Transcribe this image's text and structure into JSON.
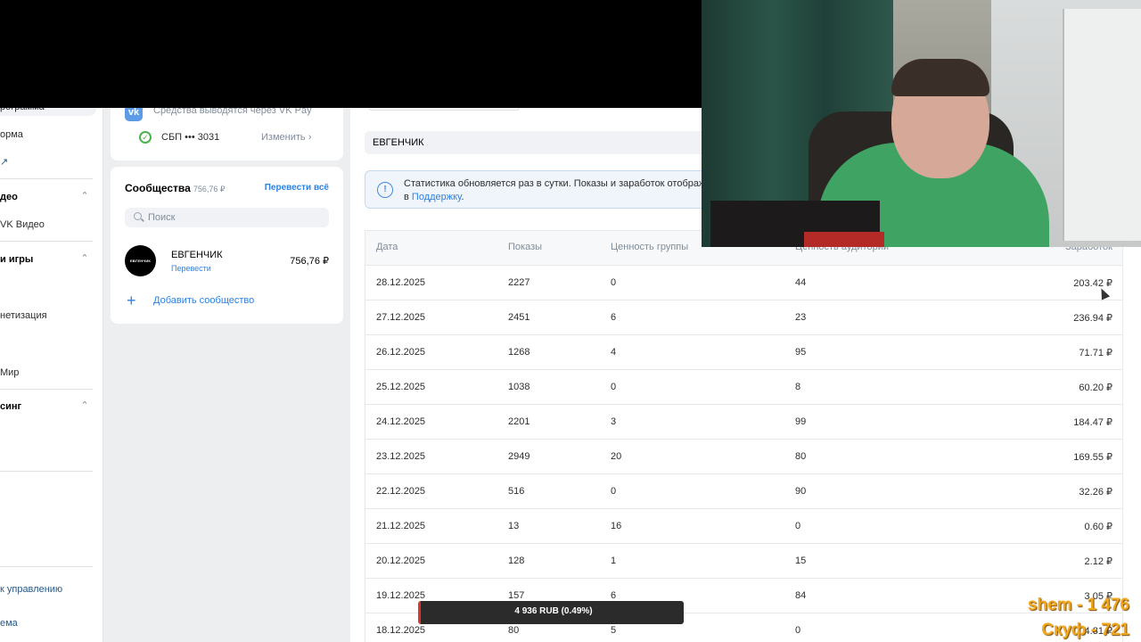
{
  "left_nav": {
    "items": [
      {
        "label": "рограмма"
      },
      {
        "label": "орма"
      },
      {
        "label": "↗"
      }
    ],
    "sections": [
      {
        "title": "део",
        "items": [
          {
            "label": "VK Видео"
          }
        ]
      },
      {
        "title": "и игры",
        "items": [
          {
            "label": "нетизация"
          },
          {
            "label": "Мир"
          }
        ]
      },
      {
        "title": "синг",
        "items": []
      }
    ],
    "footer_links": [
      {
        "label": "к управлению"
      },
      {
        "label": "ема"
      }
    ]
  },
  "payout": {
    "note": "Средства выводятся через VK Pay",
    "method": "СБП ••• 3031",
    "change_label": "Изменить"
  },
  "communities": {
    "title": "Сообщества",
    "total": "756,76 ₽",
    "transfer_all_label": "Перевести всё",
    "search_placeholder": "Поиск",
    "items": [
      {
        "avatar_text": "ЕВГЕНЧИК",
        "name": "ЕВГЕНЧИК",
        "transfer_label": "Перевести",
        "amount": "756,76 ₽"
      }
    ],
    "add_label": "Добавить сообщество"
  },
  "main": {
    "group_name": "ЕВГЕНЧИК",
    "info_line1": "Статистика обновляется раз в сутки. Показы и заработок отобража",
    "info_line2_prefix": "в ",
    "info_link": "Поддержку",
    "info_line2_suffix": ".",
    "table": {
      "headers": {
        "date": "Дата",
        "views": "Показы",
        "group_value": "Ценность группы",
        "audience_value": "Ценность аудитории",
        "earnings": "Заработок"
      },
      "rows": [
        {
          "date": "28.12.2025",
          "views": "2227",
          "group_value": "0",
          "audience_value": "44",
          "earnings": "203.42 ₽"
        },
        {
          "date": "27.12.2025",
          "views": "2451",
          "group_value": "6",
          "audience_value": "23",
          "earnings": "236.94 ₽"
        },
        {
          "date": "26.12.2025",
          "views": "1268",
          "group_value": "4",
          "audience_value": "95",
          "earnings": "71.71 ₽"
        },
        {
          "date": "25.12.2025",
          "views": "1038",
          "group_value": "0",
          "audience_value": "8",
          "earnings": "60.20 ₽"
        },
        {
          "date": "24.12.2025",
          "views": "2201",
          "group_value": "3",
          "audience_value": "99",
          "earnings": "184.47 ₽"
        },
        {
          "date": "23.12.2025",
          "views": "2949",
          "group_value": "20",
          "audience_value": "80",
          "earnings": "169.55 ₽"
        },
        {
          "date": "22.12.2025",
          "views": "516",
          "group_value": "0",
          "audience_value": "90",
          "earnings": "32.26 ₽"
        },
        {
          "date": "21.12.2025",
          "views": "13",
          "group_value": "16",
          "audience_value": "0",
          "earnings": "0.60 ₽"
        },
        {
          "date": "20.12.2025",
          "views": "128",
          "group_value": "1",
          "audience_value": "15",
          "earnings": "2.12 ₽"
        },
        {
          "date": "19.12.2025",
          "views": "157",
          "group_value": "6",
          "audience_value": "84",
          "earnings": "3.05 ₽"
        },
        {
          "date": "18.12.2025",
          "views": "80",
          "group_value": "5",
          "audience_value": "0",
          "earnings": "4.81 ₽"
        }
      ]
    }
  },
  "overlays": {
    "donation_goal": "4 936 RUB (0.49%)",
    "counter_1": "shem - 1 476",
    "counter_2": "Скуф - 721"
  },
  "icons": {
    "vk": "vk-logo-icon",
    "sbp_check": "check-circle-icon",
    "change_arrow": "chevron-right-icon",
    "search": "search-icon",
    "add": "plus-icon",
    "info": "info-icon",
    "collapse": "chevron-up-icon",
    "cursor": "mouse-cursor-icon"
  },
  "colors": {
    "accent": "#2d81e0",
    "success": "#4bb34b",
    "overlay_text": "#f2a81d"
  }
}
